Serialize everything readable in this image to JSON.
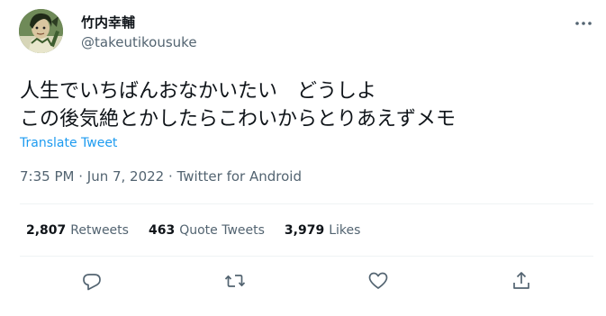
{
  "author": {
    "name": "竹内幸輔",
    "handle": "@takeutikousuke"
  },
  "tweet": {
    "text": "人生でいちばんおなかいたい　どうしよ\nこの後気絶とかしたらこわいからとりあえずメモ",
    "translate_label": "Translate Tweet"
  },
  "meta": {
    "time": "7:35 PM",
    "sep1": " · ",
    "date": "Jun 7, 2022",
    "sep2": " · ",
    "source": "Twitter for Android"
  },
  "stats": {
    "retweets": {
      "count": "2,807",
      "label": "Retweets"
    },
    "quotes": {
      "count": "463",
      "label": "Quote Tweets"
    },
    "likes": {
      "count": "3,979",
      "label": "Likes"
    }
  },
  "icons": {
    "more": "more-horizontal-icon",
    "reply": "reply-icon",
    "retweet": "retweet-icon",
    "like": "heart-icon",
    "share": "share-icon"
  },
  "colors": {
    "link": "#1d9bf0",
    "secondary_text": "#536471",
    "primary_text": "#0f1419",
    "divider": "#eff3f4"
  }
}
